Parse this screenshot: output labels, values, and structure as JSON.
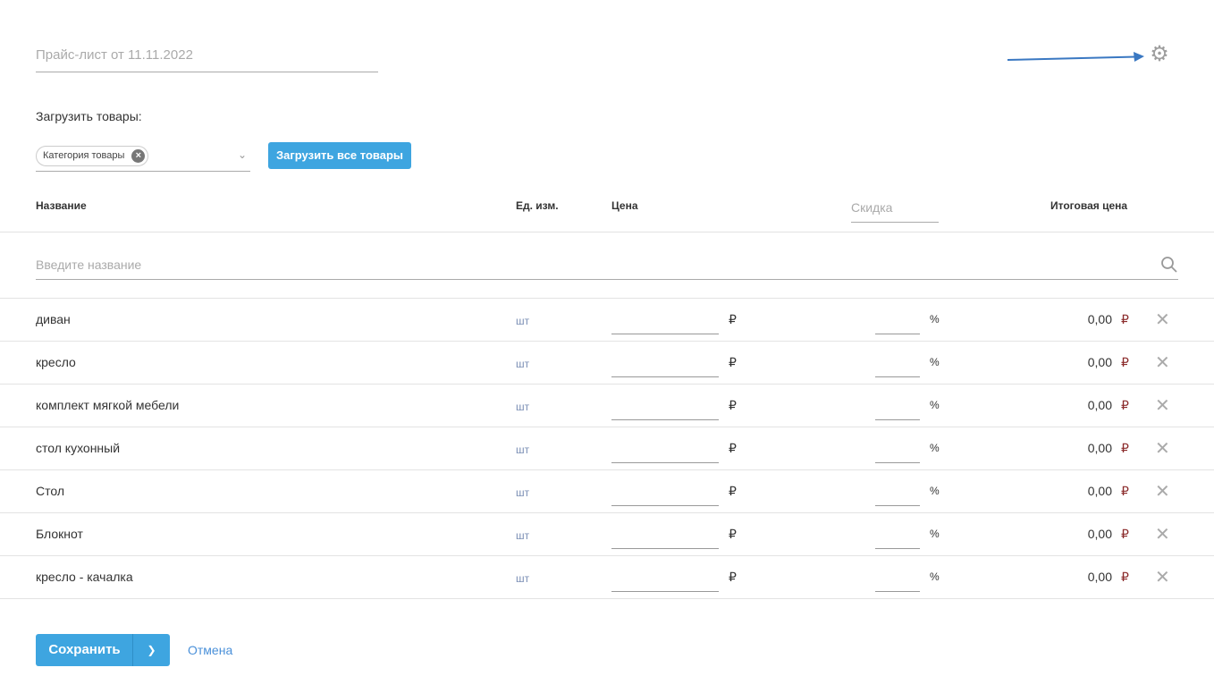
{
  "header": {
    "title_placeholder": "Прайс-лист от 11.11.2022",
    "settings_icon": "gear-icon"
  },
  "load": {
    "label": "Загрузить товары:",
    "category_chip": "Категория товары",
    "load_all_button": "Загрузить все товары"
  },
  "table": {
    "columns": {
      "name": "Название",
      "unit": "Ед. изм.",
      "price": "Цена",
      "discount": "Скидка",
      "total": "Итоговая цена"
    },
    "search_placeholder": "Введите название",
    "rows": [
      {
        "name": "диван",
        "unit": "шт",
        "price_currency": "₽",
        "discount_unit": "%",
        "total": "0,00",
        "total_currency": "₽"
      },
      {
        "name": "кресло",
        "unit": "шт",
        "price_currency": "₽",
        "discount_unit": "%",
        "total": "0,00",
        "total_currency": "₽"
      },
      {
        "name": "комплект мягкой мебели",
        "unit": "шт",
        "price_currency": "₽",
        "discount_unit": "%",
        "total": "0,00",
        "total_currency": "₽"
      },
      {
        "name": "стол кухонный",
        "unit": "шт",
        "price_currency": "₽",
        "discount_unit": "%",
        "total": "0,00",
        "total_currency": "₽"
      },
      {
        "name": "Стол",
        "unit": "шт",
        "price_currency": "₽",
        "discount_unit": "%",
        "total": "0,00",
        "total_currency": "₽"
      },
      {
        "name": "Блокнот",
        "unit": "шт",
        "price_currency": "₽",
        "discount_unit": "%",
        "total": "0,00",
        "total_currency": "₽"
      },
      {
        "name": "кресло - качалка",
        "unit": "шт",
        "price_currency": "₽",
        "discount_unit": "%",
        "total": "0,00",
        "total_currency": "₽"
      }
    ]
  },
  "footer": {
    "save_button": "Сохранить",
    "cancel_link": "Отмена"
  },
  "colors": {
    "accent": "#3ea5e0",
    "annotation_arrow": "#3a78c2"
  }
}
